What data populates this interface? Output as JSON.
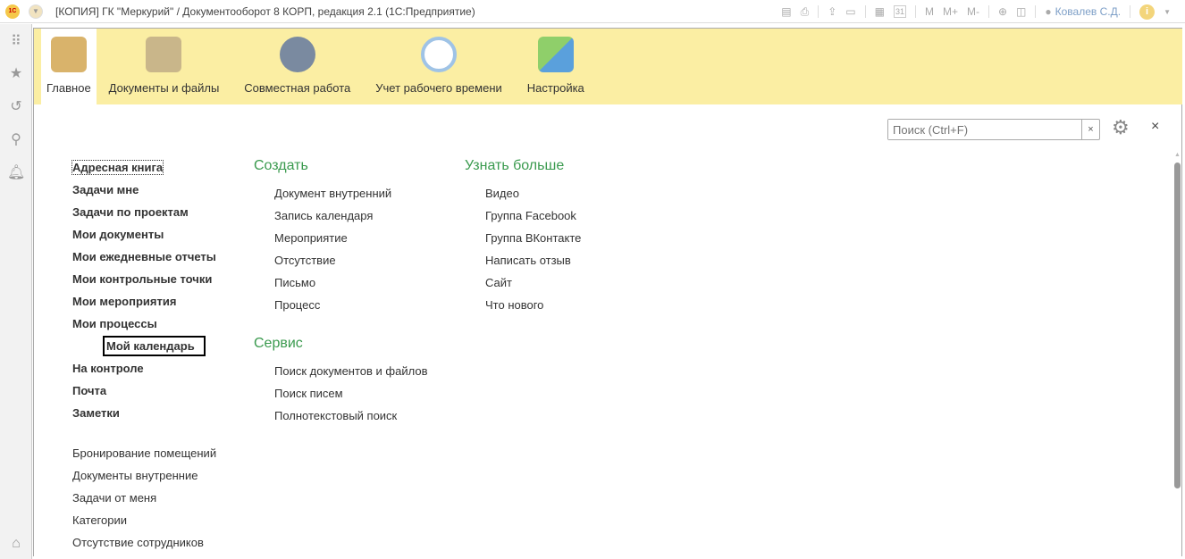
{
  "titlebar": {
    "logo": "1С",
    "title": "[КОПИЯ] ГК \"Меркурий\" / Документооборот 8 КОРП, редакция 2.1   (1С:Предприятие)",
    "m": "M",
    "mplus": "M+",
    "mminus": "M-",
    "user": "Ковалев С.Д.",
    "info": "i",
    "cal": "31"
  },
  "sections": [
    {
      "label": "Главное",
      "color": "#d9b36b"
    },
    {
      "label": "Документы и файлы",
      "color": "#c9b68a"
    },
    {
      "label": "Совместная работа",
      "color": "#7a8aa0"
    },
    {
      "label": "Учет рабочего времени",
      "color": "#9fc3e6"
    },
    {
      "label": "Настройка",
      "color": "#8fcf6a"
    }
  ],
  "search": {
    "placeholder": "Поиск (Ctrl+F)",
    "clear": "×"
  },
  "close": "×",
  "bold_links": [
    "Адресная книга",
    "Задачи мне",
    "Задачи по проектам",
    "Мои документы",
    "Мои ежедневные отчеты",
    "Мои контрольные точки",
    "Мои мероприятия",
    "Мои процессы",
    "Мой календарь",
    "На контроле",
    "Почта",
    "Заметки"
  ],
  "links": [
    "Бронирование помещений",
    "Документы внутренние",
    "Задачи от меня",
    "Категории",
    "Отсутствие сотрудников"
  ],
  "create": {
    "title": "Создать",
    "items": [
      "Документ внутренний",
      "Запись календаря",
      "Мероприятие",
      "Отсутствие",
      "Письмо",
      "Процесс"
    ]
  },
  "service": {
    "title": "Сервис",
    "items": [
      "Поиск документов и файлов",
      "Поиск писем",
      "Полнотекстовый поиск"
    ]
  },
  "more": {
    "title": "Узнать больше",
    "items": [
      "Видео",
      "Группа Facebook",
      "Группа ВКонтакте",
      "Написать отзыв",
      "Сайт",
      "Что нового"
    ]
  }
}
